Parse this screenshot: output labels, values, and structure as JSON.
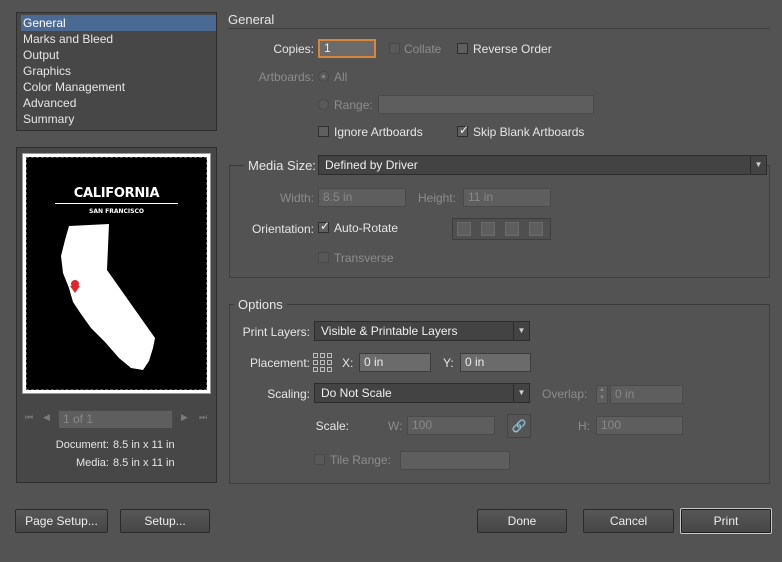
{
  "sidebar": {
    "items": [
      "General",
      "Marks and Bleed",
      "Output",
      "Graphics",
      "Color Management",
      "Advanced",
      "Summary"
    ],
    "selected": 0
  },
  "preview": {
    "poster_title": "CALIFORNIA",
    "poster_subtitle": "SAN FRANCISCO",
    "page_field": "1 of 1",
    "document_label": "Document:",
    "document_value": "8.5 in x 11 in",
    "media_label": "Media:",
    "media_value": "8.5 in x 11 in"
  },
  "general": {
    "section_title": "General",
    "copies_label": "Copies:",
    "copies_value": "1",
    "collate_label": "Collate",
    "reverse_order_label": "Reverse Order",
    "artboards_label": "Artboards:",
    "all_label": "All",
    "range_label": "Range:",
    "range_value": "",
    "ignore_artboards_label": "Ignore Artboards",
    "skip_blank_label": "Skip Blank Artboards"
  },
  "media": {
    "media_size_label": "Media Size:",
    "media_size_value": "Defined by Driver",
    "width_label": "Width:",
    "width_value": "8.5 in",
    "height_label": "Height:",
    "height_value": "11 in",
    "orientation_label": "Orientation:",
    "auto_rotate_label": "Auto-Rotate",
    "transverse_label": "Transverse"
  },
  "options": {
    "section_title": "Options",
    "print_layers_label": "Print Layers:",
    "print_layers_value": "Visible & Printable Layers",
    "placement_label": "Placement:",
    "x_label": "X:",
    "x_value": "0 in",
    "y_label": "Y:",
    "y_value": "0 in",
    "scaling_label": "Scaling:",
    "scaling_value": "Do Not Scale",
    "overlap_label": "Overlap:",
    "overlap_value": "0 in",
    "scale_label": "Scale:",
    "w_label": "W:",
    "w_value": "100",
    "h_label": "H:",
    "h_value": "100",
    "tile_range_label": "Tile Range:",
    "tile_range_value": ""
  },
  "buttons": {
    "page_setup": "Page Setup...",
    "setup": "Setup...",
    "done": "Done",
    "cancel": "Cancel",
    "print": "Print"
  },
  "colors": {
    "selection": "#4b6a93",
    "marker": "#e0262b",
    "focus_ring": "#d8863b"
  }
}
